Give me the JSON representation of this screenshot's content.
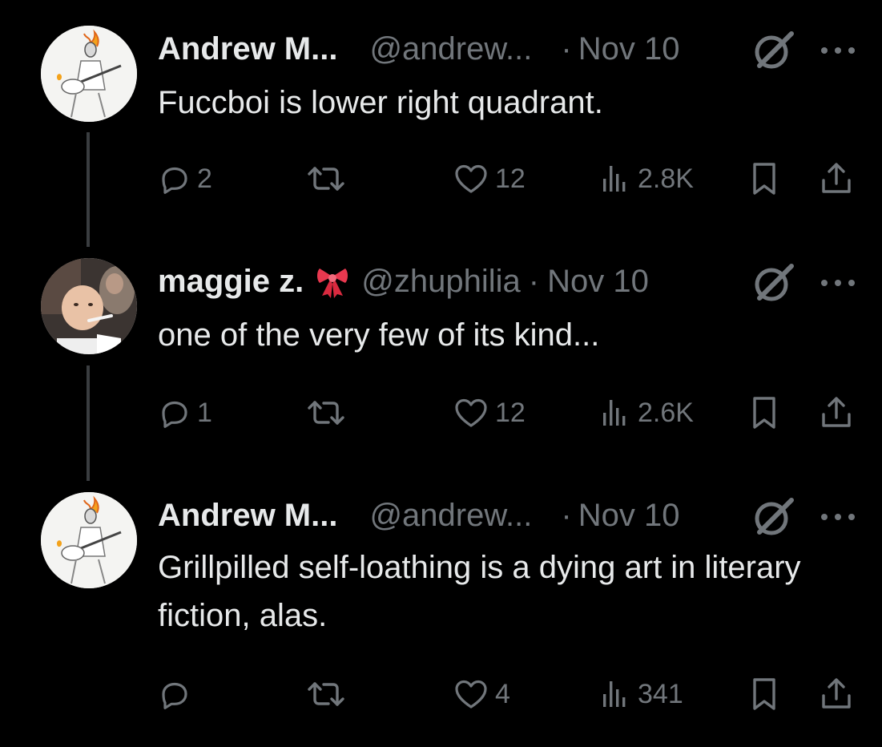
{
  "tweets": [
    {
      "name": "Andrew M...",
      "handle": "@andrew...",
      "dot": "·",
      "date": "Nov 10",
      "text": "Fuccboi is lower right quadrant.",
      "replies": "2",
      "retweets": "",
      "likes": "12",
      "views": "2.8K",
      "avatar": "guitar-sketch-avatar"
    },
    {
      "name": "maggie z.",
      "handle": "@zhuphilia",
      "dot": "·",
      "date": "Nov 10",
      "text": "one of the very few of its kind...",
      "replies": "1",
      "retweets": "",
      "likes": "12",
      "views": "2.6K",
      "avatar": "baby-photo-avatar",
      "badge": "ribbon-bow-emoji"
    },
    {
      "name": "Andrew M...",
      "handle": "@andrew...",
      "dot": "·",
      "date": "Nov 10",
      "text": "Grillpilled self-loathing is a dying art in literary fiction, alas.",
      "replies": "",
      "retweets": "",
      "likes": "4",
      "views": "341",
      "avatar": "guitar-sketch-avatar"
    }
  ],
  "icons": {
    "reply": "reply-icon",
    "retweet": "retweet-icon",
    "like": "heart-icon",
    "views": "views-icon",
    "bookmark": "bookmark-icon",
    "share": "share-icon",
    "grok": "grok-icon",
    "more": "more-icon"
  },
  "colors": {
    "background": "#000000",
    "text": "#e7e9ea",
    "muted": "#71767b",
    "thread_line": "#3a3d40",
    "ribbon": "#e8384f"
  }
}
